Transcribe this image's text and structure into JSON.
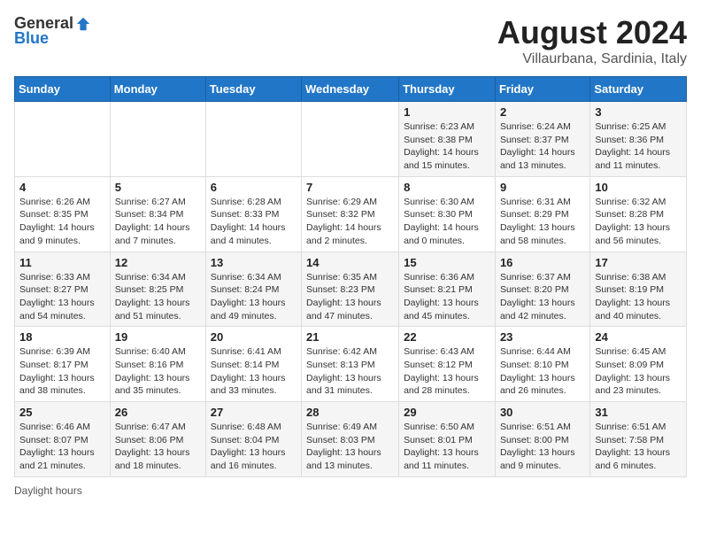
{
  "logo": {
    "general": "General",
    "blue": "Blue"
  },
  "header": {
    "title": "August 2024",
    "subtitle": "Villaurbana, Sardinia, Italy"
  },
  "days_of_week": [
    "Sunday",
    "Monday",
    "Tuesday",
    "Wednesday",
    "Thursday",
    "Friday",
    "Saturday"
  ],
  "weeks": [
    [
      {
        "day": "",
        "info": ""
      },
      {
        "day": "",
        "info": ""
      },
      {
        "day": "",
        "info": ""
      },
      {
        "day": "",
        "info": ""
      },
      {
        "day": "1",
        "info": "Sunrise: 6:23 AM\nSunset: 8:38 PM\nDaylight: 14 hours and 15 minutes."
      },
      {
        "day": "2",
        "info": "Sunrise: 6:24 AM\nSunset: 8:37 PM\nDaylight: 14 hours and 13 minutes."
      },
      {
        "day": "3",
        "info": "Sunrise: 6:25 AM\nSunset: 8:36 PM\nDaylight: 14 hours and 11 minutes."
      }
    ],
    [
      {
        "day": "4",
        "info": "Sunrise: 6:26 AM\nSunset: 8:35 PM\nDaylight: 14 hours and 9 minutes."
      },
      {
        "day": "5",
        "info": "Sunrise: 6:27 AM\nSunset: 8:34 PM\nDaylight: 14 hours and 7 minutes."
      },
      {
        "day": "6",
        "info": "Sunrise: 6:28 AM\nSunset: 8:33 PM\nDaylight: 14 hours and 4 minutes."
      },
      {
        "day": "7",
        "info": "Sunrise: 6:29 AM\nSunset: 8:32 PM\nDaylight: 14 hours and 2 minutes."
      },
      {
        "day": "8",
        "info": "Sunrise: 6:30 AM\nSunset: 8:30 PM\nDaylight: 14 hours and 0 minutes."
      },
      {
        "day": "9",
        "info": "Sunrise: 6:31 AM\nSunset: 8:29 PM\nDaylight: 13 hours and 58 minutes."
      },
      {
        "day": "10",
        "info": "Sunrise: 6:32 AM\nSunset: 8:28 PM\nDaylight: 13 hours and 56 minutes."
      }
    ],
    [
      {
        "day": "11",
        "info": "Sunrise: 6:33 AM\nSunset: 8:27 PM\nDaylight: 13 hours and 54 minutes."
      },
      {
        "day": "12",
        "info": "Sunrise: 6:34 AM\nSunset: 8:25 PM\nDaylight: 13 hours and 51 minutes."
      },
      {
        "day": "13",
        "info": "Sunrise: 6:34 AM\nSunset: 8:24 PM\nDaylight: 13 hours and 49 minutes."
      },
      {
        "day": "14",
        "info": "Sunrise: 6:35 AM\nSunset: 8:23 PM\nDaylight: 13 hours and 47 minutes."
      },
      {
        "day": "15",
        "info": "Sunrise: 6:36 AM\nSunset: 8:21 PM\nDaylight: 13 hours and 45 minutes."
      },
      {
        "day": "16",
        "info": "Sunrise: 6:37 AM\nSunset: 8:20 PM\nDaylight: 13 hours and 42 minutes."
      },
      {
        "day": "17",
        "info": "Sunrise: 6:38 AM\nSunset: 8:19 PM\nDaylight: 13 hours and 40 minutes."
      }
    ],
    [
      {
        "day": "18",
        "info": "Sunrise: 6:39 AM\nSunset: 8:17 PM\nDaylight: 13 hours and 38 minutes."
      },
      {
        "day": "19",
        "info": "Sunrise: 6:40 AM\nSunset: 8:16 PM\nDaylight: 13 hours and 35 minutes."
      },
      {
        "day": "20",
        "info": "Sunrise: 6:41 AM\nSunset: 8:14 PM\nDaylight: 13 hours and 33 minutes."
      },
      {
        "day": "21",
        "info": "Sunrise: 6:42 AM\nSunset: 8:13 PM\nDaylight: 13 hours and 31 minutes."
      },
      {
        "day": "22",
        "info": "Sunrise: 6:43 AM\nSunset: 8:12 PM\nDaylight: 13 hours and 28 minutes."
      },
      {
        "day": "23",
        "info": "Sunrise: 6:44 AM\nSunset: 8:10 PM\nDaylight: 13 hours and 26 minutes."
      },
      {
        "day": "24",
        "info": "Sunrise: 6:45 AM\nSunset: 8:09 PM\nDaylight: 13 hours and 23 minutes."
      }
    ],
    [
      {
        "day": "25",
        "info": "Sunrise: 6:46 AM\nSunset: 8:07 PM\nDaylight: 13 hours and 21 minutes."
      },
      {
        "day": "26",
        "info": "Sunrise: 6:47 AM\nSunset: 8:06 PM\nDaylight: 13 hours and 18 minutes."
      },
      {
        "day": "27",
        "info": "Sunrise: 6:48 AM\nSunset: 8:04 PM\nDaylight: 13 hours and 16 minutes."
      },
      {
        "day": "28",
        "info": "Sunrise: 6:49 AM\nSunset: 8:03 PM\nDaylight: 13 hours and 13 minutes."
      },
      {
        "day": "29",
        "info": "Sunrise: 6:50 AM\nSunset: 8:01 PM\nDaylight: 13 hours and 11 minutes."
      },
      {
        "day": "30",
        "info": "Sunrise: 6:51 AM\nSunset: 8:00 PM\nDaylight: 13 hours and 9 minutes."
      },
      {
        "day": "31",
        "info": "Sunrise: 6:51 AM\nSunset: 7:58 PM\nDaylight: 13 hours and 6 minutes."
      }
    ]
  ],
  "footer": {
    "text": "Daylight hours"
  }
}
